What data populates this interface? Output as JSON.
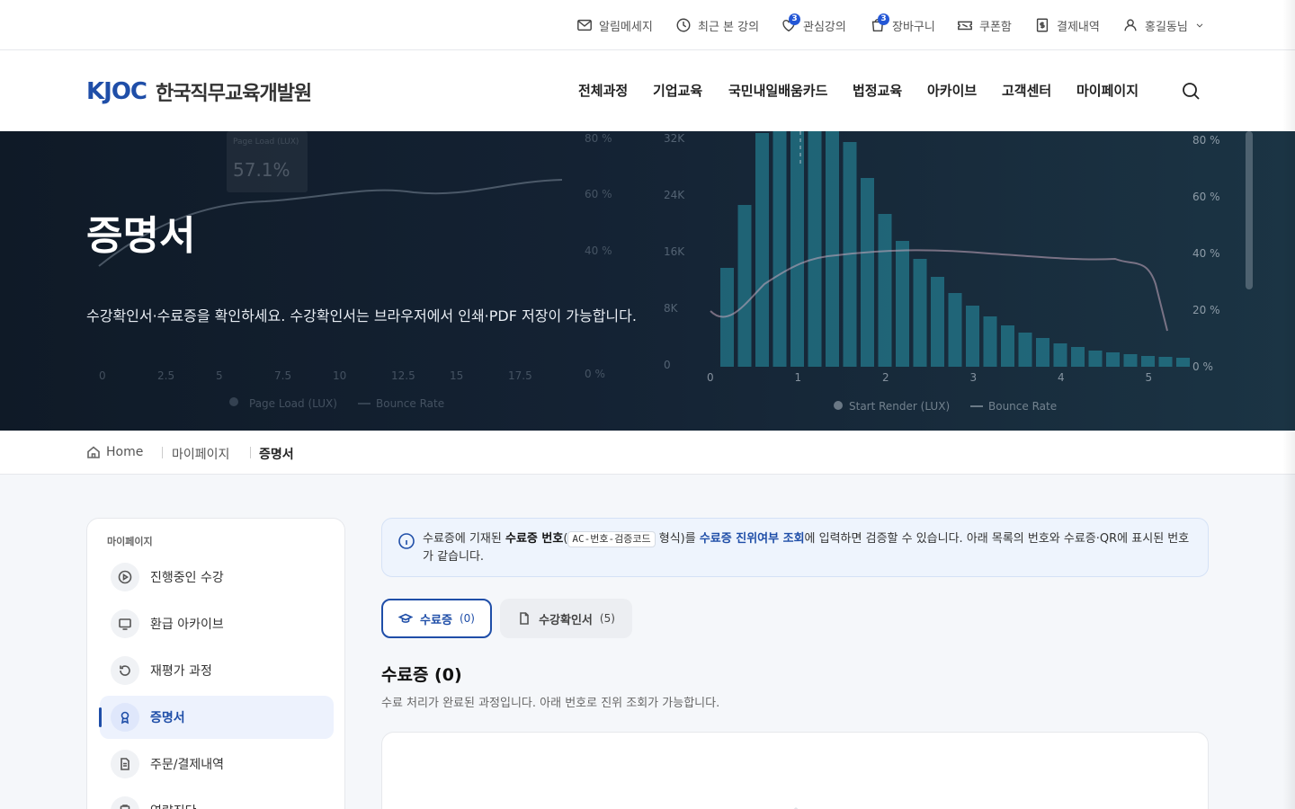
{
  "util_bar": {
    "items": [
      {
        "label": "알림메세지",
        "icon": "mail-icon"
      },
      {
        "label": "최근 본 강의",
        "icon": "clock-icon"
      },
      {
        "label": "관심강의",
        "icon": "heart-icon",
        "badge": "3"
      },
      {
        "label": "장바구니",
        "icon": "cart-icon",
        "badge": "3"
      },
      {
        "label": "쿠폰함",
        "icon": "ticket-icon"
      },
      {
        "label": "결제내역",
        "icon": "receipt-icon"
      },
      {
        "label": "홍길동님",
        "icon": "user-icon"
      }
    ]
  },
  "header": {
    "logo_mark": "KJOC",
    "logo_text": "한국직무교육개발원",
    "nav": [
      "전체과정",
      "기업교육",
      "국민내일배움카드",
      "법정교육",
      "아카이브",
      "고객센터",
      "마이페이지"
    ]
  },
  "hero": {
    "title": "증명서",
    "description": "수강확인서·수료증을 확인하세요. 수강확인서는 브라우저에서 인쇄·PDF 저장이 가능합니다.",
    "bg_chart": {
      "left_callout": "57.1%",
      "left_callout_sub": "Page Load (LUX)",
      "left_x_ticks": [
        "0",
        "2.5",
        "5",
        "7.5",
        "10",
        "12.5",
        "15",
        "17.5"
      ],
      "left_y_ticks": [
        "80 %",
        "60 %",
        "40 %",
        "0 %"
      ],
      "left_legend": [
        "Page Load (LUX)",
        "Bounce Rate"
      ],
      "right_y_left_ticks": [
        "32K",
        "24K",
        "16K",
        "8K",
        "0"
      ],
      "right_y_right_ticks": [
        "80 %",
        "60 %",
        "40 %",
        "20 %",
        "0 %"
      ],
      "right_x_ticks": [
        "0",
        "1",
        "2",
        "3",
        "4",
        "5"
      ],
      "right_legend": [
        "Start Render (LUX)",
        "Bounce Rate"
      ]
    }
  },
  "breadcrumb": {
    "items": [
      "Home",
      "마이페이지",
      "증명서"
    ]
  },
  "sidebar": {
    "heading": "마이페이지",
    "items": [
      {
        "label": "진행중인 수강",
        "icon": "play-icon"
      },
      {
        "label": "환급 아카이브",
        "icon": "monitor-icon"
      },
      {
        "label": "재평가 과정",
        "icon": "refresh-icon"
      },
      {
        "label": "증명서",
        "icon": "award-icon",
        "active": true
      },
      {
        "label": "주문/결제내역",
        "icon": "document-icon"
      },
      {
        "label": "역량진단",
        "icon": "clipboard-icon"
      }
    ]
  },
  "info": {
    "part1": "수료증에 기재된 ",
    "bold": "수료증 번호",
    "code": "AC-번호-검증코드",
    "part2": " 형식)를 ",
    "link": "수료증 진위여부 조회",
    "part3": "에 입력하면 검증할 수 있습니다. 아래 목록의 번호와 수료증·QR에 표시된 번호가 같습니다."
  },
  "tabs": [
    {
      "label": "수료증",
      "count": "(0)",
      "icon": "graduation-cap-icon"
    },
    {
      "label": "수강확인서",
      "count": "(5)",
      "icon": "file-icon"
    }
  ],
  "section": {
    "title": "수료증 (0)",
    "description": "수료 처리가 완료된 과정입니다. 아래 번호로 진위 조회가 가능합니다."
  },
  "colors": {
    "accent": "#1f4ea8",
    "badge": "#2457d6",
    "hero_bg": "#142233"
  }
}
